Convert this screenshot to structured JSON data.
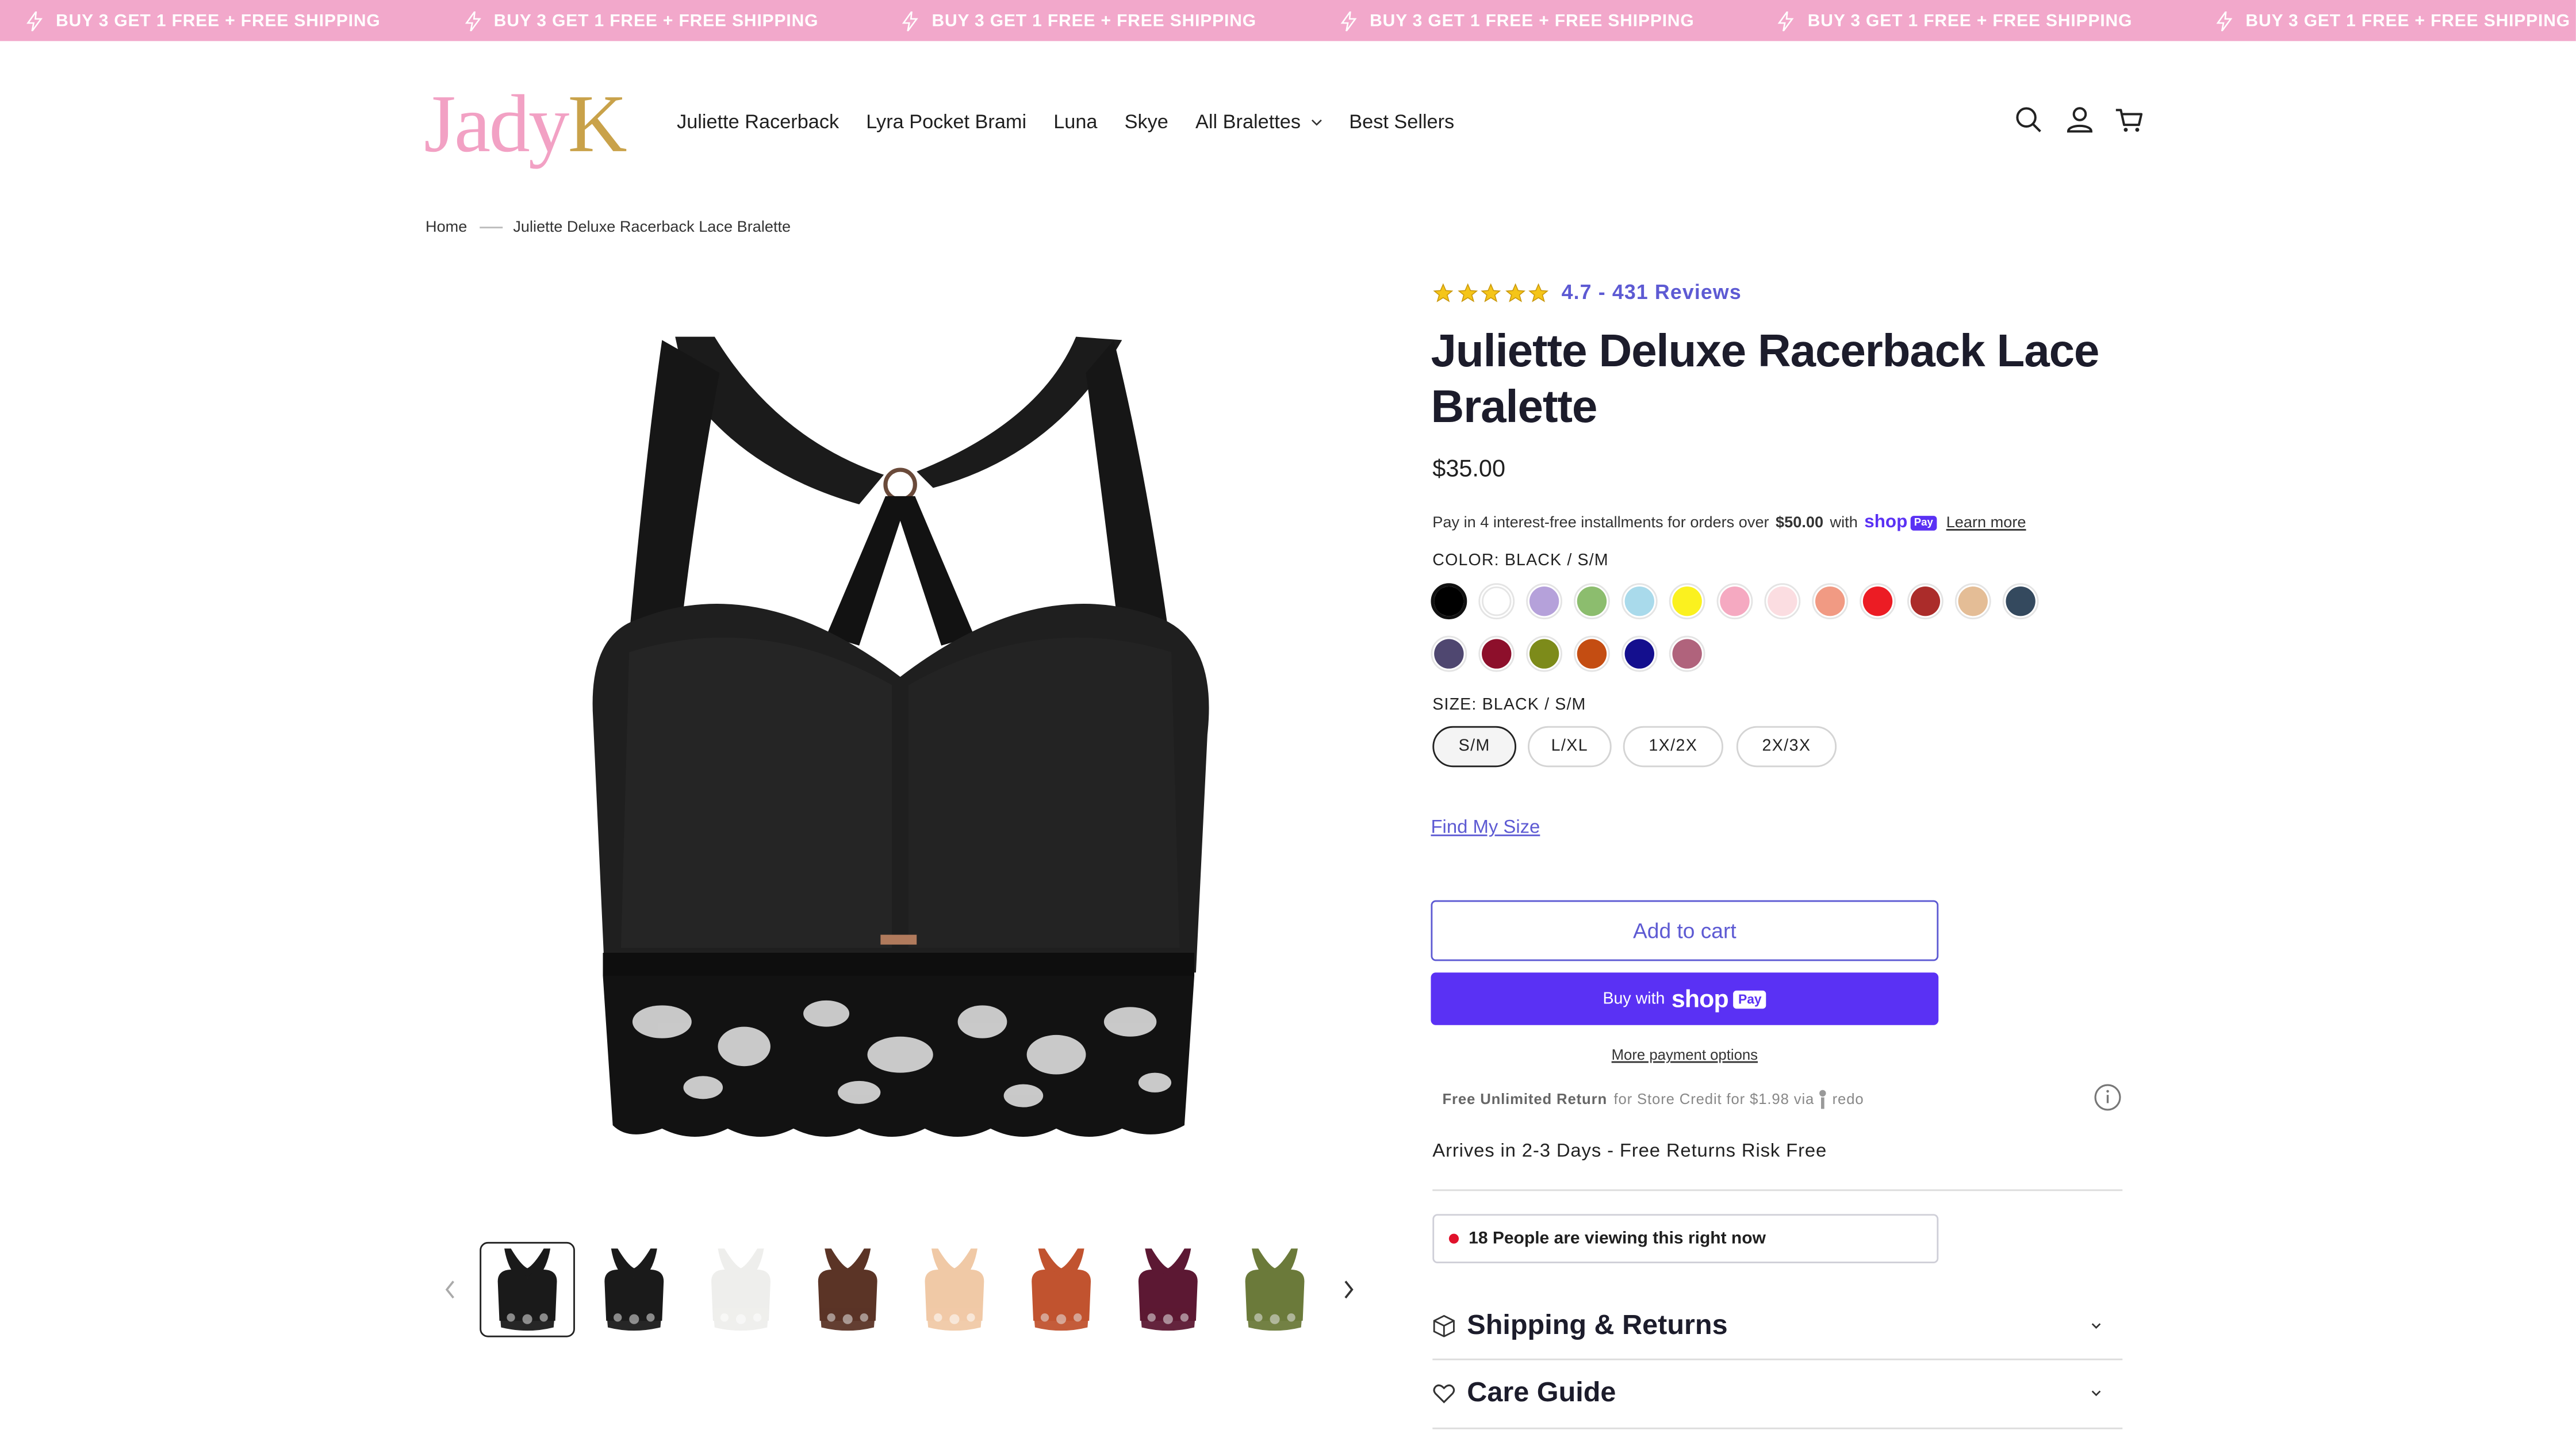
{
  "announcement": {
    "text": "BUY 3 GET 1 FREE + FREE SHIPPING",
    "repeat": [
      "BUY 3 GET 1 FREE + FREE SHIPPING",
      "BUY 3 GET 1 FREE + FREE SHIPPING",
      "BUY 3 GET 1 FREE + FREE SHIPPING",
      "BUY 3 GET 1 FREE + FREE SHIPPING",
      "BUY 3 GET 1 FREE + FREE SHIPPING",
      "BUY 3 GET 1 FREE + FREE SHIPPING",
      "BUY 3 GET 1 FREE + FREE SHIPPING"
    ],
    "bg": "#f2a8cb",
    "icon": "lightning-bolt-icon"
  },
  "header": {
    "logo_part1": "Jady",
    "logo_part2": "K",
    "nav": [
      {
        "label": "Juliette Racerback"
      },
      {
        "label": "Lyra Pocket Brami"
      },
      {
        "label": "Luna"
      },
      {
        "label": "Skye"
      },
      {
        "label": "All Bralettes",
        "dropdown": true
      },
      {
        "label": "Best Sellers"
      }
    ],
    "icons": [
      "search-icon",
      "account-icon",
      "cart-icon"
    ]
  },
  "breadcrumb": {
    "home": "Home",
    "current": "Juliette Deluxe Racerback Lace Bralette"
  },
  "gallery": {
    "thumb_colors": [
      "#1a1a1a",
      "#1a1a1a",
      "#eeeeec",
      "#5b3426",
      "#f0c9a6",
      "#c1532f",
      "#5c1833",
      "#6b7a3a"
    ],
    "active_index": 0
  },
  "product": {
    "rating_value": 4.7,
    "rating_text": "4.7 - 431 Reviews",
    "title": "Juliette Deluxe Racerback Lace Bralette",
    "price": "$35.00",
    "installments_pre": "Pay in 4 interest-free installments for orders over",
    "installments_amount": "$50.00",
    "installments_with": "with",
    "shop": "shop",
    "pay": "Pay",
    "learn_more": "Learn more",
    "color_label": "COLOR:",
    "color_value": "BLACK / S/M",
    "colors": [
      "#000000",
      "#ffffff",
      "#b5a1da",
      "#8cbd6e",
      "#a9daeb",
      "#fbf11f",
      "#f5a9c1",
      "#fbdde1",
      "#f19a83",
      "#ec1c24",
      "#ab2c2a",
      "#e4bd96",
      "#34495e",
      "#4f4770",
      "#8d0f2b",
      "#7d8b1a",
      "#c44d12",
      "#140f8e",
      "#b0637c"
    ],
    "size_label": "SIZE:",
    "size_value": "BLACK / S/M",
    "sizes": [
      "S/M",
      "L/XL",
      "1X/2X",
      "2X/3X"
    ],
    "selected_size": 0,
    "find_size": "Find My Size",
    "add_to_cart": "Add to cart",
    "buy_with": "Buy with",
    "more_payment": "More payment options",
    "redo_bold": "Free Unlimited Return",
    "redo_text": "for Store Credit for $1.98 via",
    "redo_brand": "redo",
    "arrives": "Arrives in 2-3 Days - Free Returns Risk Free",
    "viewers": "18 People are viewing this right now",
    "accordions": [
      "Shipping & Returns",
      "Care Guide"
    ]
  },
  "colors": {
    "accent": "#5d5ad3",
    "shop_pay": "#5a31f4",
    "logo_pink": "#f2a1c4",
    "logo_gold": "#c9a24a"
  }
}
